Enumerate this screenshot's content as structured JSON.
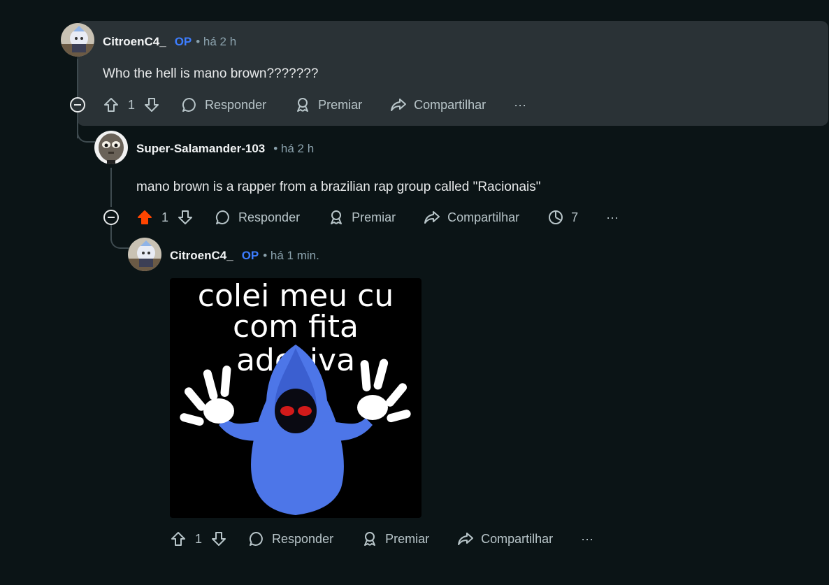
{
  "comments": [
    {
      "username": "CitroenC4_",
      "op_badge": "OP",
      "time": "• há 2 h",
      "body": "Who the hell is mano brown???????",
      "votes": "1",
      "reply_label": "Responder",
      "award_label": "Premiar",
      "share_label": "Compartilhar",
      "more_label": "···"
    },
    {
      "username": "Super-Salamander-103",
      "time": "• há 2 h",
      "body": "mano brown is a rapper from a brazilian rap group called \"Racionais\"",
      "votes": "1",
      "upvoted": true,
      "reply_label": "Responder",
      "award_label": "Premiar",
      "share_label": "Compartilhar",
      "views": "7",
      "more_label": "···"
    },
    {
      "username": "CitroenC4_",
      "op_badge": "OP",
      "time": "• há 1 min.",
      "meme_text": [
        "colei meu cu",
        "com fita adesiva"
      ],
      "votes": "1",
      "reply_label": "Responder",
      "award_label": "Premiar",
      "share_label": "Compartilhar",
      "more_label": "···"
    }
  ],
  "colors": {
    "background": "#0b1416",
    "highlight": "#2a3236",
    "op_badge": "#3d7dff",
    "upvote_active": "#ff4500"
  },
  "icons": [
    "upvote-icon",
    "downvote-icon",
    "comment-bubble-icon",
    "award-icon",
    "share-icon",
    "views-icon",
    "more-icon",
    "collapse-icon"
  ]
}
